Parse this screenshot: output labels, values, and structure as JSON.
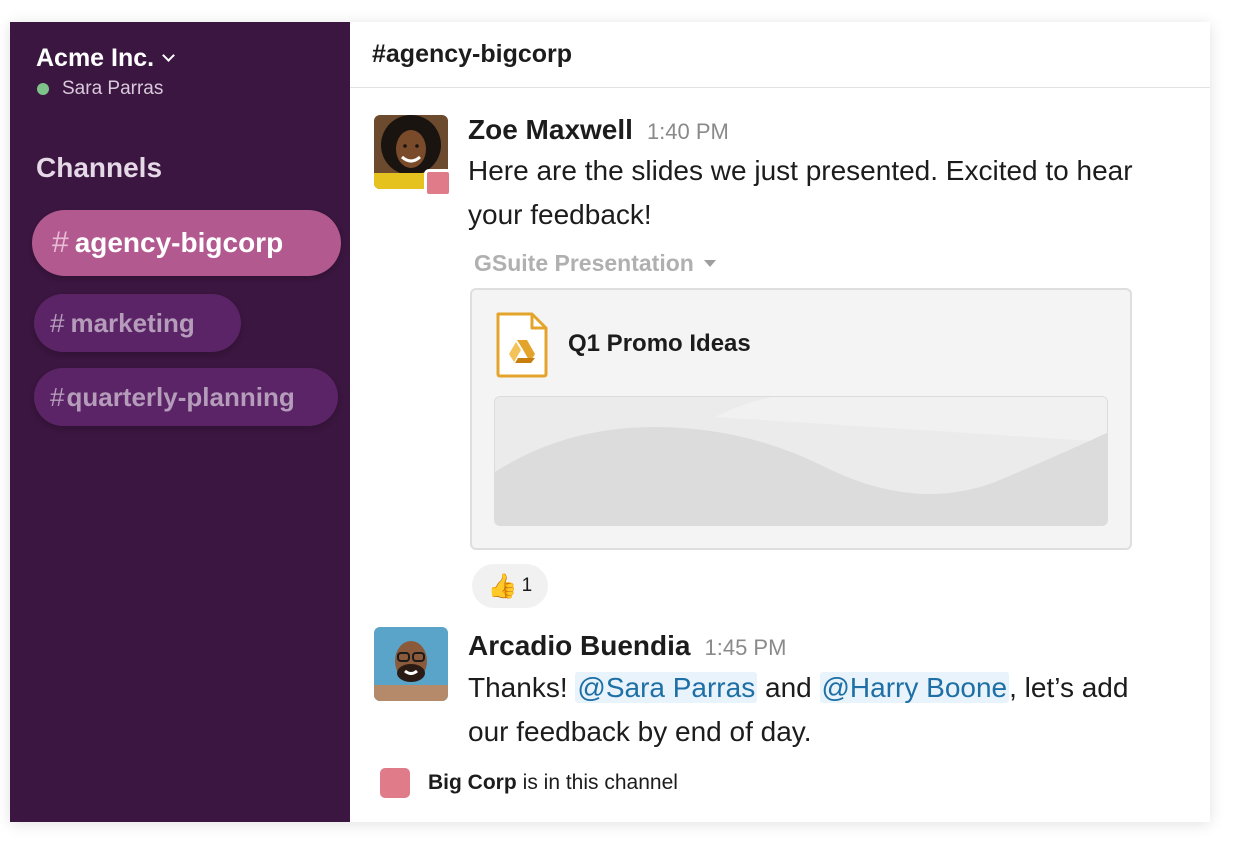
{
  "workspace": {
    "name": "Acme Inc.",
    "user": "Sara Parras",
    "presence_color": "#7ec38a"
  },
  "sidebar": {
    "section_title": "Channels",
    "channels": [
      {
        "hash": "#",
        "name": "agency-bigcorp",
        "active": true
      },
      {
        "hash": "#",
        "name": "marketing",
        "active": false
      },
      {
        "hash": "#",
        "name": "quarterly-planning",
        "active": false
      }
    ]
  },
  "channel": {
    "title": "#agency-bigcorp"
  },
  "messages": [
    {
      "author": "Zoe Maxwell",
      "time": "1:40 PM",
      "text": "Here are the slides we just presented. Excited to hear your feedback!",
      "attachment": {
        "label": "GSuite Presentation",
        "file_title": "Q1 Promo Ideas",
        "icon": "google-drive-icon"
      },
      "reaction": {
        "emoji": "👍",
        "count": "1"
      }
    },
    {
      "author": "Arcadio Buendia",
      "time": "1:45 PM",
      "text_parts": [
        "Thanks! ",
        "@Sara Parras",
        " and ",
        "@Harry Boone",
        ", let’s add our feedback by end of day."
      ]
    }
  ],
  "footer": {
    "org": "Big Corp",
    "text": "is in this channel",
    "color": "#e07c8a"
  },
  "colors": {
    "sidebar": "#3b1640",
    "active_channel": "#b25a8f",
    "inactive_channel": "#5b2466",
    "mention": "#1d6fa5"
  }
}
